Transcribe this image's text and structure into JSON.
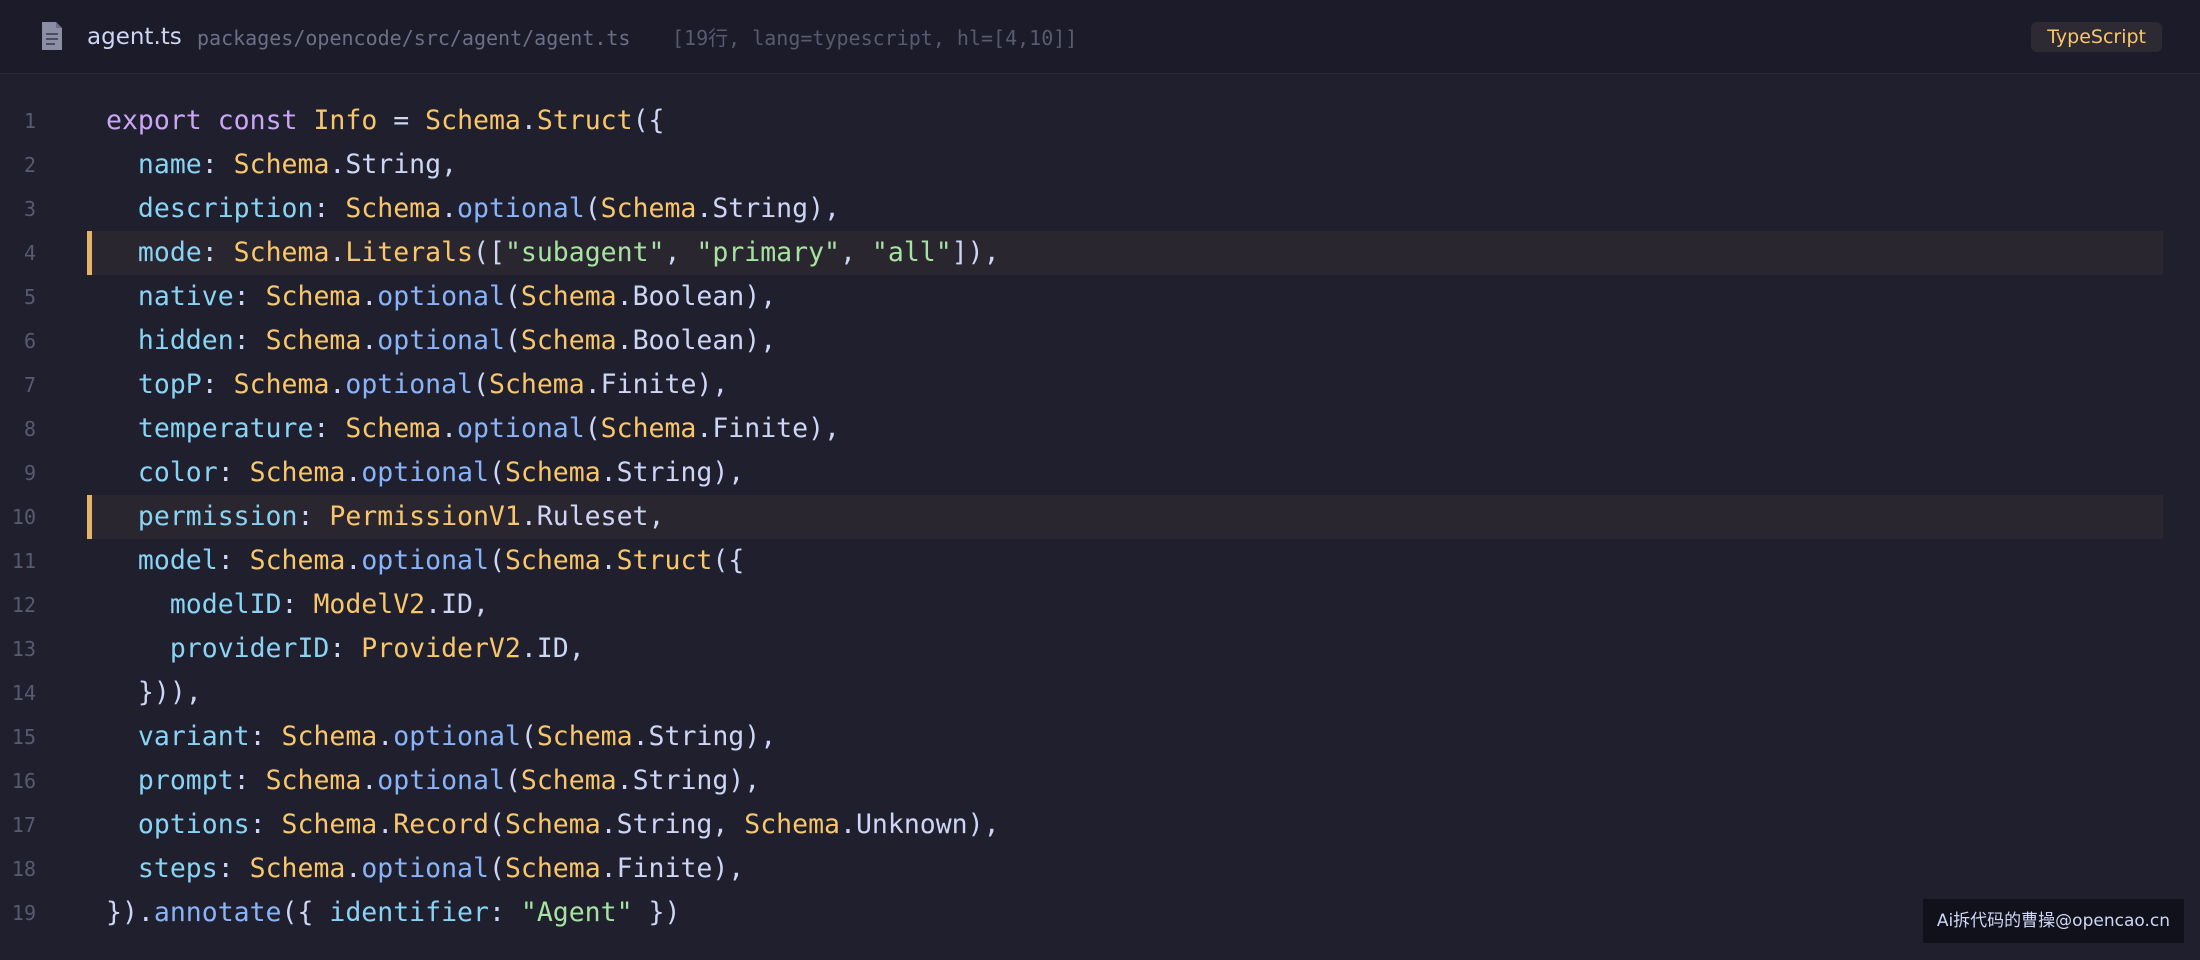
{
  "header": {
    "file_name": "agent.ts",
    "file_path": "packages/opencode/src/agent/agent.ts",
    "file_meta": "[19行, lang=typescript, hl=[4,10]]",
    "language_badge": "TypeScript",
    "file_icon": "file-icon"
  },
  "colors": {
    "background": "#1f1f2e",
    "highlight_bar": "#e5b567",
    "keyword": "#cba6f7",
    "type": "#f9c76a",
    "function": "#89b4fa",
    "property": "#89d4f5",
    "string": "#a6e3a1"
  },
  "code": {
    "highlighted_lines": [
      4,
      10
    ],
    "lines": [
      [
        [
          "kw",
          "export"
        ],
        [
          "pu",
          " "
        ],
        [
          "kw",
          "const"
        ],
        [
          "pu",
          " "
        ],
        [
          "ty",
          "Info"
        ],
        [
          "pu",
          " = "
        ],
        [
          "ty",
          "Schema"
        ],
        [
          "pu",
          "."
        ],
        [
          "ty",
          "Struct"
        ],
        [
          "pu",
          "({"
        ]
      ],
      [
        [
          "pu",
          "  "
        ],
        [
          "pr",
          "name"
        ],
        [
          "pu",
          ": "
        ],
        [
          "ty",
          "Schema"
        ],
        [
          "pu",
          ".String,"
        ]
      ],
      [
        [
          "pu",
          "  "
        ],
        [
          "pr",
          "description"
        ],
        [
          "pu",
          ": "
        ],
        [
          "ty",
          "Schema"
        ],
        [
          "pu",
          "."
        ],
        [
          "fn",
          "optional"
        ],
        [
          "pu",
          "("
        ],
        [
          "ty",
          "Schema"
        ],
        [
          "pu",
          ".String),"
        ]
      ],
      [
        [
          "pu",
          "  "
        ],
        [
          "pr",
          "mode"
        ],
        [
          "pu",
          ": "
        ],
        [
          "ty",
          "Schema"
        ],
        [
          "pu",
          "."
        ],
        [
          "ty",
          "Literals"
        ],
        [
          "pu",
          "(["
        ],
        [
          "st",
          "\"subagent\""
        ],
        [
          "pu",
          ", "
        ],
        [
          "st",
          "\"primary\""
        ],
        [
          "pu",
          ", "
        ],
        [
          "st",
          "\"all\""
        ],
        [
          "pu",
          "]),"
        ]
      ],
      [
        [
          "pu",
          "  "
        ],
        [
          "pr",
          "native"
        ],
        [
          "pu",
          ": "
        ],
        [
          "ty",
          "Schema"
        ],
        [
          "pu",
          "."
        ],
        [
          "fn",
          "optional"
        ],
        [
          "pu",
          "("
        ],
        [
          "ty",
          "Schema"
        ],
        [
          "pu",
          ".Boolean),"
        ]
      ],
      [
        [
          "pu",
          "  "
        ],
        [
          "pr",
          "hidden"
        ],
        [
          "pu",
          ": "
        ],
        [
          "ty",
          "Schema"
        ],
        [
          "pu",
          "."
        ],
        [
          "fn",
          "optional"
        ],
        [
          "pu",
          "("
        ],
        [
          "ty",
          "Schema"
        ],
        [
          "pu",
          ".Boolean),"
        ]
      ],
      [
        [
          "pu",
          "  "
        ],
        [
          "pr",
          "topP"
        ],
        [
          "pu",
          ": "
        ],
        [
          "ty",
          "Schema"
        ],
        [
          "pu",
          "."
        ],
        [
          "fn",
          "optional"
        ],
        [
          "pu",
          "("
        ],
        [
          "ty",
          "Schema"
        ],
        [
          "pu",
          ".Finite),"
        ]
      ],
      [
        [
          "pu",
          "  "
        ],
        [
          "pr",
          "temperature"
        ],
        [
          "pu",
          ": "
        ],
        [
          "ty",
          "Schema"
        ],
        [
          "pu",
          "."
        ],
        [
          "fn",
          "optional"
        ],
        [
          "pu",
          "("
        ],
        [
          "ty",
          "Schema"
        ],
        [
          "pu",
          ".Finite),"
        ]
      ],
      [
        [
          "pu",
          "  "
        ],
        [
          "pr",
          "color"
        ],
        [
          "pu",
          ": "
        ],
        [
          "ty",
          "Schema"
        ],
        [
          "pu",
          "."
        ],
        [
          "fn",
          "optional"
        ],
        [
          "pu",
          "("
        ],
        [
          "ty",
          "Schema"
        ],
        [
          "pu",
          ".String),"
        ]
      ],
      [
        [
          "pu",
          "  "
        ],
        [
          "pr",
          "permission"
        ],
        [
          "pu",
          ": "
        ],
        [
          "ty",
          "PermissionV1"
        ],
        [
          "pu",
          ".Ruleset,"
        ]
      ],
      [
        [
          "pu",
          "  "
        ],
        [
          "pr",
          "model"
        ],
        [
          "pu",
          ": "
        ],
        [
          "ty",
          "Schema"
        ],
        [
          "pu",
          "."
        ],
        [
          "fn",
          "optional"
        ],
        [
          "pu",
          "("
        ],
        [
          "ty",
          "Schema"
        ],
        [
          "pu",
          "."
        ],
        [
          "ty",
          "Struct"
        ],
        [
          "pu",
          "({"
        ]
      ],
      [
        [
          "pu",
          "    "
        ],
        [
          "pr",
          "modelID"
        ],
        [
          "pu",
          ": "
        ],
        [
          "ty",
          "ModelV2"
        ],
        [
          "pu",
          ".ID,"
        ]
      ],
      [
        [
          "pu",
          "    "
        ],
        [
          "pr",
          "providerID"
        ],
        [
          "pu",
          ": "
        ],
        [
          "ty",
          "ProviderV2"
        ],
        [
          "pu",
          ".ID,"
        ]
      ],
      [
        [
          "pu",
          "  })),"
        ]
      ],
      [
        [
          "pu",
          "  "
        ],
        [
          "pr",
          "variant"
        ],
        [
          "pu",
          ": "
        ],
        [
          "ty",
          "Schema"
        ],
        [
          "pu",
          "."
        ],
        [
          "fn",
          "optional"
        ],
        [
          "pu",
          "("
        ],
        [
          "ty",
          "Schema"
        ],
        [
          "pu",
          ".String),"
        ]
      ],
      [
        [
          "pu",
          "  "
        ],
        [
          "pr",
          "prompt"
        ],
        [
          "pu",
          ": "
        ],
        [
          "ty",
          "Schema"
        ],
        [
          "pu",
          "."
        ],
        [
          "fn",
          "optional"
        ],
        [
          "pu",
          "("
        ],
        [
          "ty",
          "Schema"
        ],
        [
          "pu",
          ".String),"
        ]
      ],
      [
        [
          "pu",
          "  "
        ],
        [
          "pr",
          "options"
        ],
        [
          "pu",
          ": "
        ],
        [
          "ty",
          "Schema"
        ],
        [
          "pu",
          "."
        ],
        [
          "ty",
          "Record"
        ],
        [
          "pu",
          "("
        ],
        [
          "ty",
          "Schema"
        ],
        [
          "pu",
          ".String, "
        ],
        [
          "ty",
          "Schema"
        ],
        [
          "pu",
          ".Unknown),"
        ]
      ],
      [
        [
          "pu",
          "  "
        ],
        [
          "pr",
          "steps"
        ],
        [
          "pu",
          ": "
        ],
        [
          "ty",
          "Schema"
        ],
        [
          "pu",
          "."
        ],
        [
          "fn",
          "optional"
        ],
        [
          "pu",
          "("
        ],
        [
          "ty",
          "Schema"
        ],
        [
          "pu",
          ".Finite),"
        ]
      ],
      [
        [
          "pu",
          "})."
        ],
        [
          "fn",
          "annotate"
        ],
        [
          "pu",
          "({ "
        ],
        [
          "pr",
          "identifier"
        ],
        [
          "pu",
          ": "
        ],
        [
          "st",
          "\"Agent\""
        ],
        [
          "pu",
          " })"
        ]
      ]
    ]
  },
  "watermark": {
    "text": "Ai拆代码的曹操@opencao.cn"
  }
}
